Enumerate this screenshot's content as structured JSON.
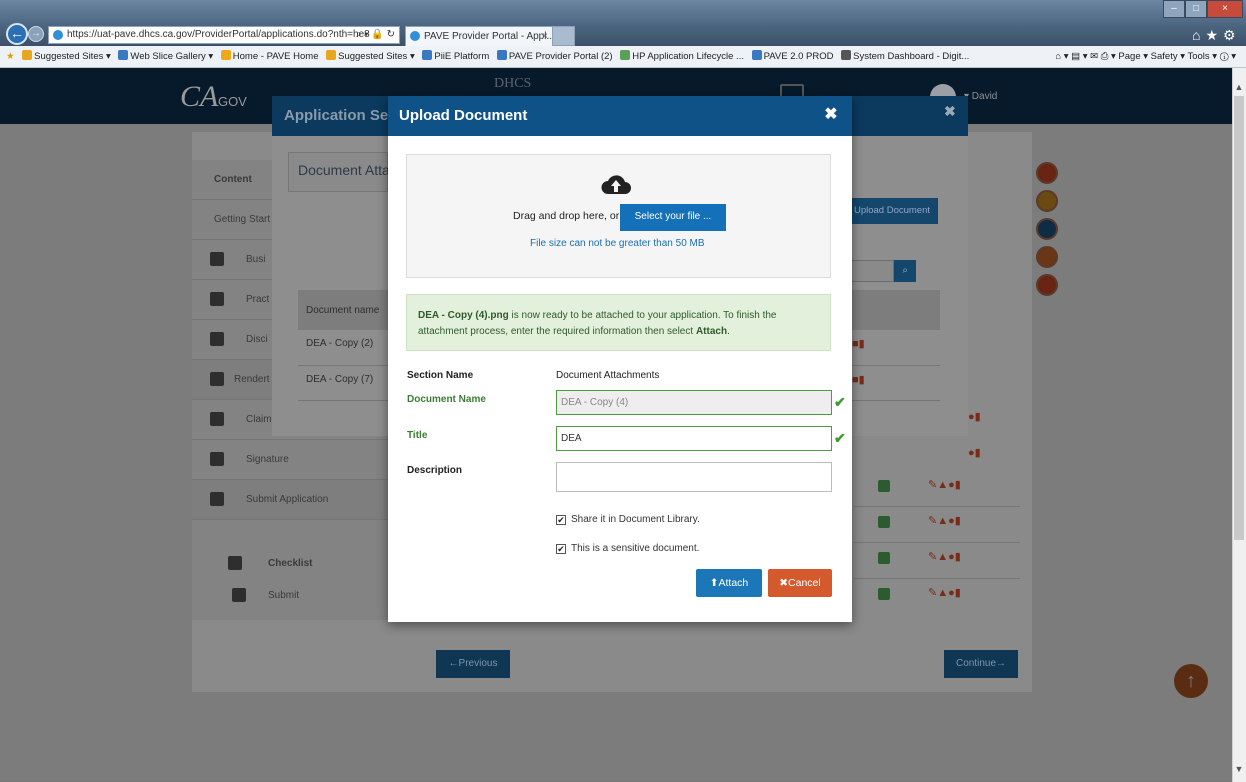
{
  "browser": {
    "url": "https://uat-pave.dhcs.ca.gov/ProviderPortal/applications.do?nth=he8",
    "url_controls": "⌕ ▾ 🔒 ↻",
    "tab_title": "PAVE Provider Portal - Appl...",
    "tab_close": "×",
    "favorites": [
      "Suggested Sites ▾",
      "Web Slice Gallery ▾",
      "Home - PAVE Home",
      "Suggested Sites ▾",
      "PiiE Platform",
      "PAVE Provider Portal (2)",
      "HP Application Lifecycle ...",
      "PAVE 2.0 PROD",
      "System Dashboard - Digit..."
    ],
    "toolbar_right": "⌂ ▾  ▤ ▾  ✉  ⎙ ▾  Page ▾  Safety ▾  Tools ▾  ⓘ ▾",
    "window_controls": {
      "min": "–",
      "max": "□",
      "close": "×"
    },
    "right_icons": "⌂★⚙"
  },
  "page": {
    "logo": "CA",
    "logo_suffix": ".GOV",
    "dhcs": "DHCS",
    "user": "▾ David",
    "left_nav": [
      {
        "label": "Content"
      },
      {
        "label": "Getting Start"
      },
      {
        "label": "Busi"
      },
      {
        "label": "Pract"
      },
      {
        "label": "Disci"
      },
      {
        "label": "Rendert"
      },
      {
        "label": "Claim"
      },
      {
        "label": "Signature"
      },
      {
        "label": "Submit Application"
      },
      {
        "label": "Checklist"
      },
      {
        "label": "Submit"
      }
    ],
    "section_title": "Application Sec",
    "section_close": "✖",
    "doc_attach_label": "Document Atta",
    "upload_doc_button": "Upload Document",
    "search_icon": "⌕",
    "table_header_docname": "Document name",
    "rows": [
      "DEA - Copy (2)",
      "DEA - Copy (7)"
    ],
    "prev_button": "←Previous",
    "continue_button": "Continue→",
    "up_arrow": "↑"
  },
  "modal": {
    "title": "Upload Document",
    "close": "✖",
    "drag_label": "Drag and drop here, or",
    "select_button": "Select your file ...",
    "size_note": "File size can not be greater than 50 MB",
    "alert_filename": "DEA - Copy (4).png",
    "alert_text": " is now ready to be attached to your application. To finish the attachment process, enter the required information then select ",
    "alert_attach": "Attach",
    "alert_end": ".",
    "section_name_label": "Section Name",
    "section_name_value": "Document Attachments",
    "document_name_label": "Document Name",
    "document_name_value": "DEA - Copy (4)",
    "title_label": "Title",
    "title_value": "DEA",
    "description_label": "Description",
    "description_value": "",
    "share_label": "Share it in Document Library.",
    "sensitive_label": "This is a sensitive document.",
    "check_mark": "✔",
    "attach_button": "⬆Attach",
    "cancel_button": "✖Cancel"
  },
  "colors": {
    "modal_header": "#0f5287",
    "primary": "#1c77b9",
    "danger": "#d45a2e",
    "success": "#3b7d33"
  }
}
